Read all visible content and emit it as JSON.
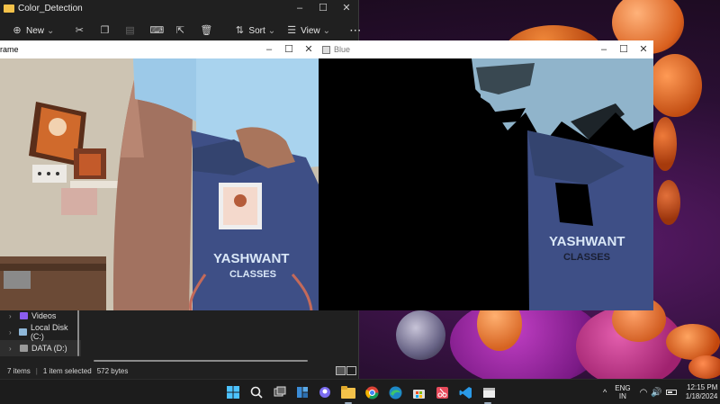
{
  "explorer": {
    "title": "Color_Detection",
    "window_controls": [
      "–",
      "☐",
      "✕"
    ],
    "toolbar": {
      "new_label": "New",
      "new_chevron": "⌄",
      "sort_label": "Sort",
      "sort_chevron": "⌄",
      "view_label": "View",
      "view_chevron": "⌄",
      "more_label": "···"
    },
    "nav_items": [
      {
        "label": "Videos",
        "chevron": "›"
      },
      {
        "label": "Local Disk (C:)",
        "chevron": "›"
      },
      {
        "label": "DATA (D:)",
        "chevron": "›"
      }
    ],
    "status": {
      "items": "7 items",
      "selected": "1 item selected",
      "size": "572 bytes"
    }
  },
  "frame_window": {
    "title": "rame",
    "controls": [
      "–",
      "☐",
      "✕"
    ],
    "shirt_text_1": "YASHWANT",
    "shirt_text_2": "CLASSES"
  },
  "blue_window": {
    "title": "Blue",
    "controls": [
      "–",
      "☐",
      "✕"
    ],
    "shirt_text_1": "YASHWANT",
    "shirt_text_2": "CLASSES"
  },
  "taskbar": {
    "apps": [
      "start",
      "search",
      "task-view",
      "widgets",
      "chat",
      "file-explorer",
      "chrome",
      "edge",
      "store",
      "snipping",
      "vscode",
      "opencv"
    ],
    "tray": {
      "chevron": "^",
      "lang_top": "ENG",
      "lang_bottom": "IN",
      "time": "12:15 PM",
      "date": "1/18/2024"
    }
  },
  "colors": {
    "explorer_bg": "#202020",
    "taskbar_bg": "#1c1c1c",
    "folder_yellow": "#f4c24a",
    "shirt_light_blue": "#a9d3ee",
    "bag_navy": "#3e4f86"
  }
}
